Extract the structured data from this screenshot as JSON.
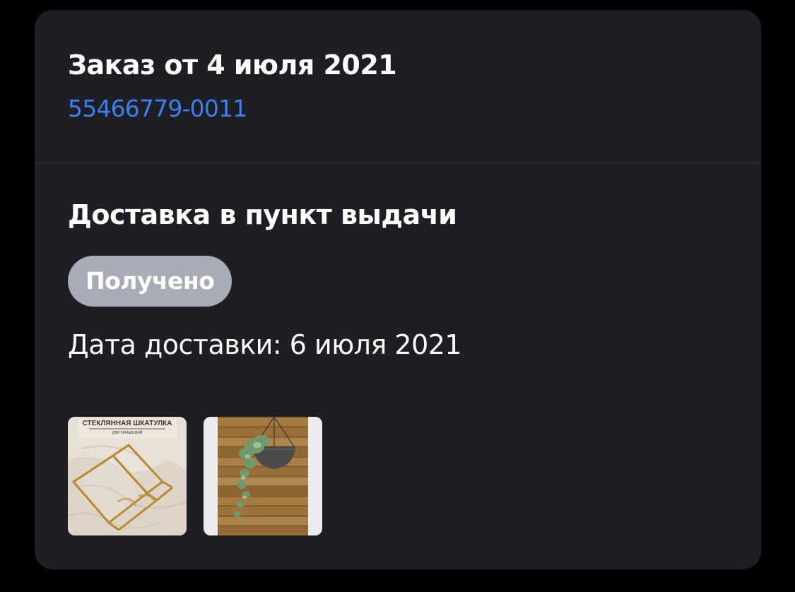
{
  "order": {
    "title": "Заказ от 4 июля 2021",
    "number": "55466779-0011"
  },
  "delivery": {
    "method": "Доставка в пункт выдачи",
    "status": "Получено",
    "date_text": "Дата доставки: 6 июля 2021"
  },
  "items": [
    {
      "caption_main": "СТЕКЛЯННАЯ ШКАТУЛКА",
      "caption_sub": "ДЛЯ УКРАШЕНИЙ"
    },
    {}
  ],
  "colors": {
    "background": "#000000",
    "card": "#1d1f25",
    "link": "#3d7ff0",
    "badge": "#a7acb7",
    "divider": "#3a3c43"
  }
}
